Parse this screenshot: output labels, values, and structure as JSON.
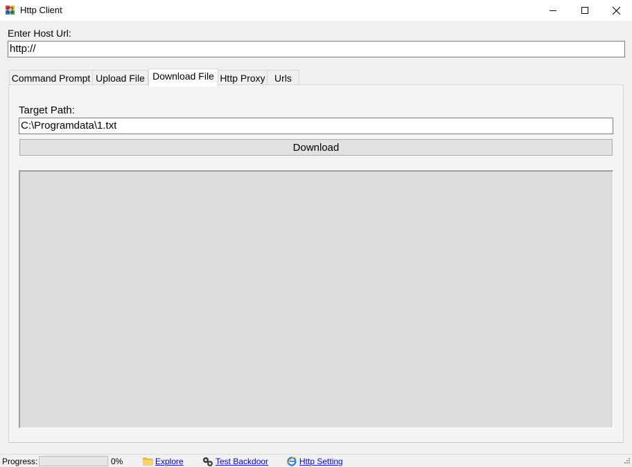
{
  "window": {
    "title": "Http Client",
    "minimize_icon": "minimize-icon",
    "maximize_icon": "maximize-icon",
    "close_icon": "close-icon"
  },
  "host": {
    "label": "Enter Host Url:",
    "value": "http://"
  },
  "tabs": [
    {
      "label": "Command Prompt"
    },
    {
      "label": "Upload File"
    },
    {
      "label": "Download File",
      "active": true
    },
    {
      "label": "Http Proxy"
    },
    {
      "label": "Urls"
    }
  ],
  "download": {
    "target_label": "Target Path:",
    "target_value": "C:\\Programdata\\1.txt",
    "button_label": "Download",
    "output_text": ""
  },
  "status": {
    "progress_label": "Progress:",
    "progress_value": 0,
    "progress_text": "0%",
    "explore_label": "Explore",
    "explore_icon": "folder-icon",
    "test_backdoor_label": "Test Backdoor",
    "test_backdoor_icon": "gears-icon",
    "http_setting_label": "Http Setting",
    "http_setting_icon": "ie-icon"
  },
  "colors": {
    "window_bg": "#f0f0f0",
    "link": "#0000ee",
    "output_bg": "#dcdcdc",
    "progress_fill": "#06b025"
  }
}
